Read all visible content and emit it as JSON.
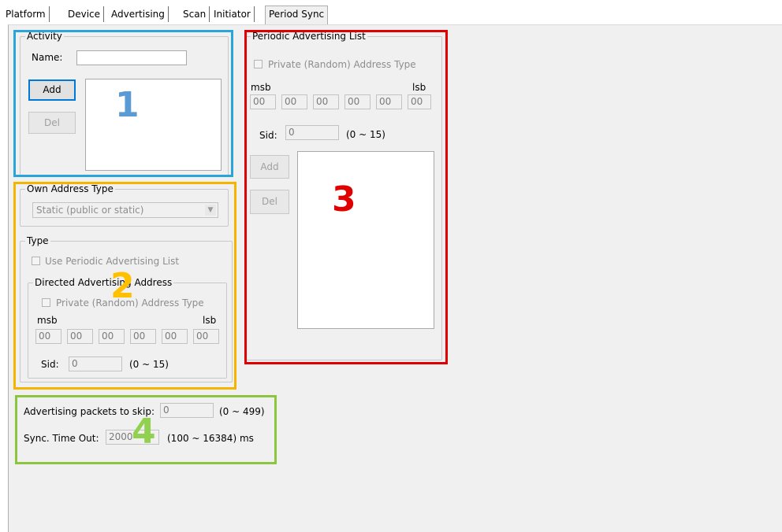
{
  "tabs": [
    "Platform",
    "Device",
    "Advertising",
    "Scan",
    "Initiator",
    "Period Sync"
  ],
  "activity": {
    "legend": "Activity",
    "name_label": "Name:",
    "name_value": "",
    "add_label": "Add",
    "del_label": "Del"
  },
  "own_address": {
    "legend": "Own Address Type",
    "selected": "Static (public or static)",
    "arrow": "▼"
  },
  "type_group": {
    "legend": "Type",
    "use_list_label": "Use Periodic Advertising List"
  },
  "directed": {
    "legend": "Directed Advertising Address",
    "private_label": "Private (Random) Address Type",
    "msb": "msb",
    "lsb": "lsb",
    "bytes": [
      "00",
      "00",
      "00",
      "00",
      "00",
      "00"
    ],
    "sid_label": "Sid:",
    "sid_value": "0",
    "sid_range": "(0 ~ 15)"
  },
  "periodic_list": {
    "legend": "Periodic Advertising List",
    "private_label": "Private (Random) Address Type",
    "msb": "msb",
    "lsb": "lsb",
    "bytes": [
      "00",
      "00",
      "00",
      "00",
      "00",
      "00"
    ],
    "sid_label": "Sid:",
    "sid_value": "0",
    "sid_range": "(0 ~ 15)",
    "add_label": "Add",
    "del_label": "Del"
  },
  "sync": {
    "skip_label": "Advertising packets to skip:",
    "skip_value": "0",
    "skip_range": "(0 ~ 499)",
    "timeout_label": "Sync. Time Out:",
    "timeout_value": "2000",
    "timeout_range": "(100 ~ 16384) ms"
  },
  "annotations": {
    "n1": "1",
    "n2": "2",
    "n3": "3",
    "n4": "4",
    "color1": "#2aa5dc",
    "color2": "#f5b400",
    "color3": "#e00000",
    "color4": "#8cc63f",
    "num1_color": "#5b9bd5",
    "num2_color": "#ffc000",
    "num3_color": "#e00000",
    "num4_color": "#92d050"
  }
}
